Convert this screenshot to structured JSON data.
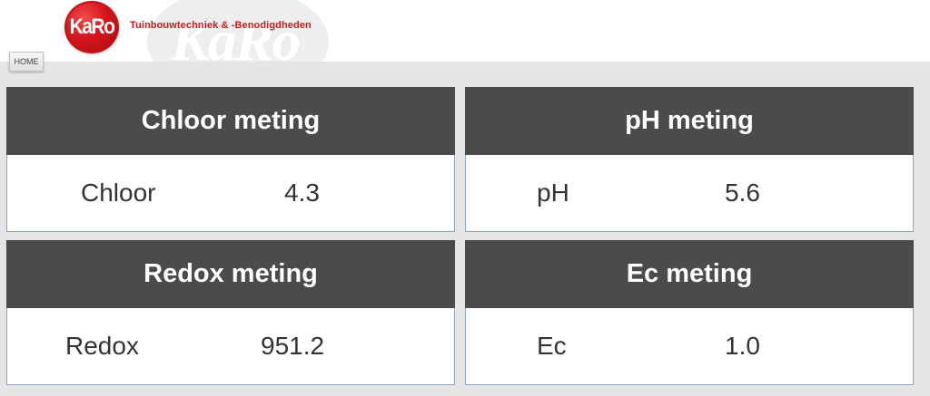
{
  "header": {
    "logo_text": "KaRo",
    "tagline": "Tuinbouwtechniek & -Benodigdheden",
    "watermark_text": "KaRo"
  },
  "nav": {
    "home_label": "HOME"
  },
  "panels": [
    {
      "title": "Chloor meting",
      "label": "Chloor",
      "value": "4.3"
    },
    {
      "title": "pH meting",
      "label": "pH",
      "value": "5.6"
    },
    {
      "title": "Redox meting",
      "label": "Redox",
      "value": "951.2"
    },
    {
      "title": "Ec meting",
      "label": "Ec",
      "value": "1.0"
    }
  ],
  "colors": {
    "panel_header": "#4b4b4d",
    "page_background": "#e5e5e5",
    "brand_red": "#c81a1e",
    "panel_border": "#8da4c4"
  }
}
